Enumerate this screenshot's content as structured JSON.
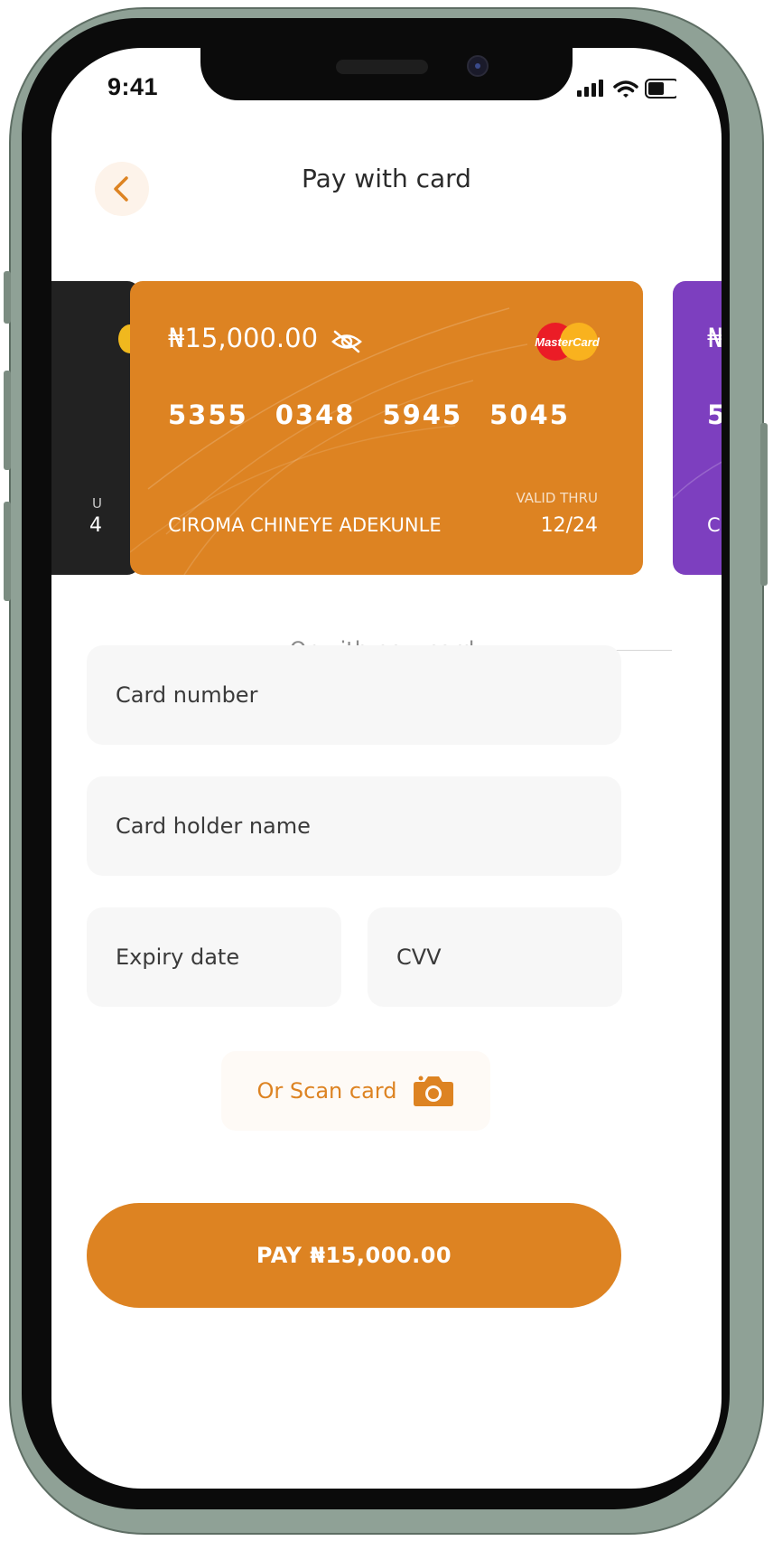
{
  "status_bar": {
    "time": "9:41"
  },
  "header": {
    "title": "Pay with card",
    "back_icon": "chevron-left-icon"
  },
  "cards": {
    "left_peek": {
      "amount_fragment": "",
      "valid_fragment": "U",
      "expiry_fragment": "4"
    },
    "main": {
      "amount": "₦15,000.00",
      "number_groups": [
        "5355",
        "0348",
        "5945",
        "5045"
      ],
      "holder": "CIROMA CHINEYE ADEKUNLE",
      "valid_label": "VALID THRU",
      "valid_value": "12/24",
      "brand": "MasterCard"
    },
    "right_peek": {
      "amount_fragment": "₦",
      "number_fragment": "5",
      "holder_fragment": "C"
    }
  },
  "divider": {
    "label": "Or with new card"
  },
  "form": {
    "card_number_placeholder": "Card number",
    "holder_placeholder": "Card holder name",
    "expiry_placeholder": "Expiry date",
    "cvv_placeholder": "CVV"
  },
  "scan": {
    "label": "Or Scan card",
    "icon": "camera-icon"
  },
  "pay_button": {
    "label": "PAY ₦15,000.00"
  },
  "colors": {
    "accent": "#dd8322",
    "dark_card": "#222222",
    "purple_card": "#7d3fbf",
    "field_bg": "#f7f7f7"
  }
}
